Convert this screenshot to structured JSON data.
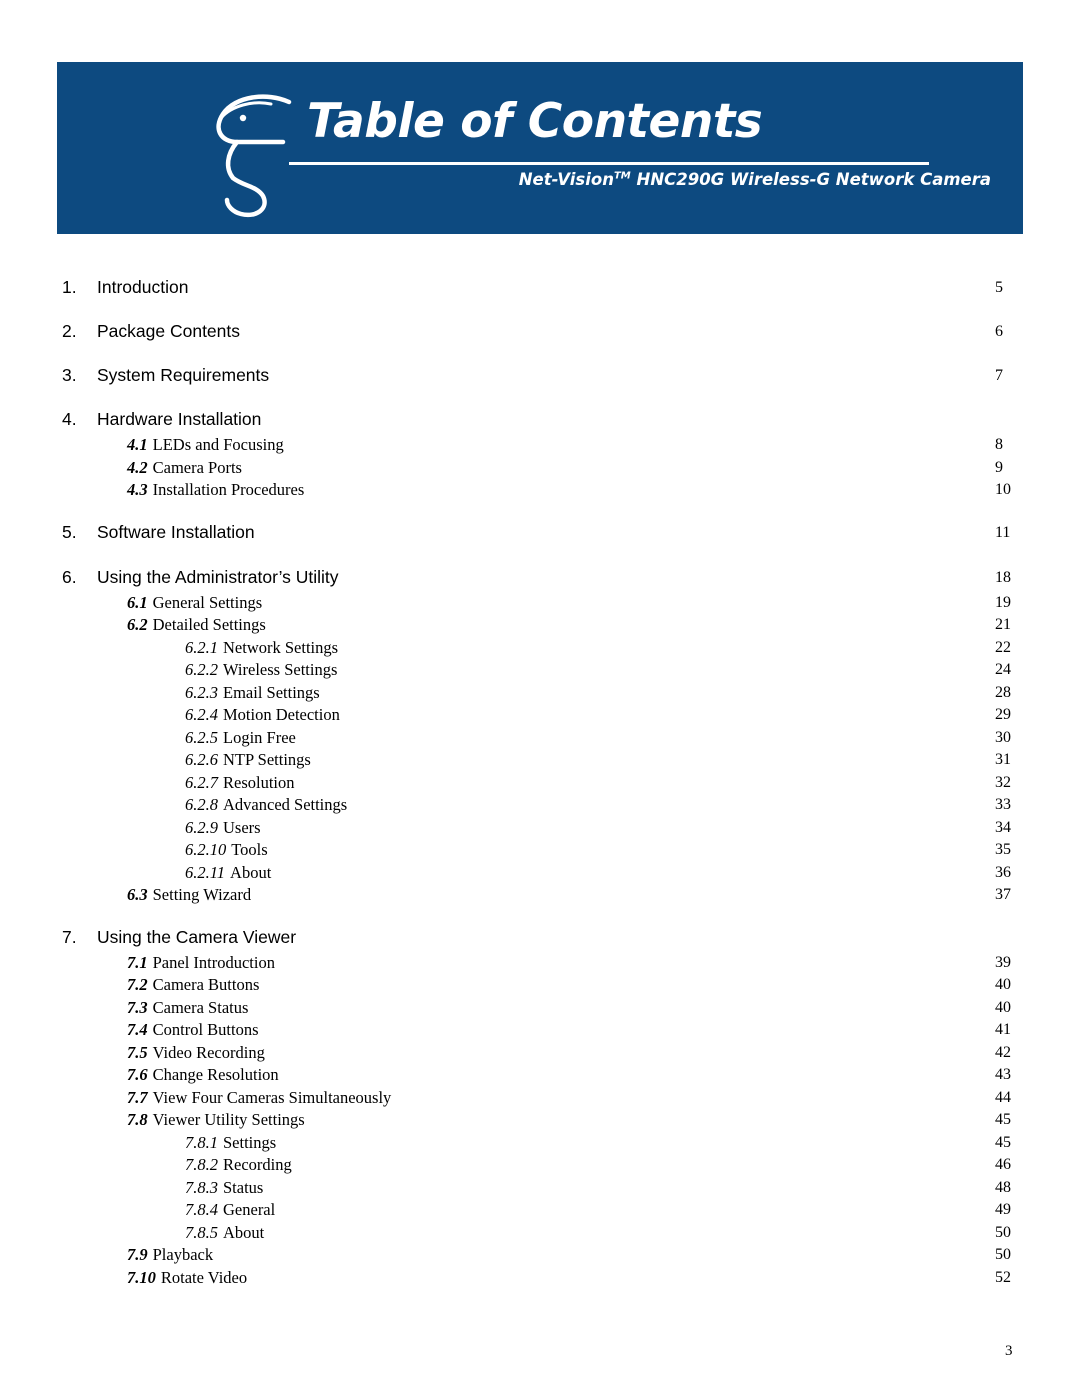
{
  "header": {
    "title": "Table of Contents",
    "subtitle_prefix": "Net-Vision",
    "subtitle_tm": "TM",
    "subtitle_rest": " HNC290G Wireless-G Network Camera",
    "banner_color": "#0d4a80",
    "logo_icon": "bird-head-logo"
  },
  "toc": {
    "entries": [
      {
        "level": 1,
        "num": "1.",
        "label": "Introduction",
        "page": "5",
        "spaced": false
      },
      {
        "level": 1,
        "num": "2.",
        "label": "Package Contents",
        "page": "6",
        "spaced": false
      },
      {
        "level": 1,
        "num": "3.",
        "label": "System Requirements",
        "page": "7",
        "spaced": false
      },
      {
        "level": 1,
        "num": "4.",
        "label": "Hardware Installation",
        "page": "",
        "spaced": false
      },
      {
        "level": 2,
        "num": "4.1",
        "label": "LEDs and Focusing",
        "page": "8",
        "spaced": false
      },
      {
        "level": 2,
        "num": "4.2",
        "label": "Camera Ports",
        "page": "9",
        "spaced": false
      },
      {
        "level": 2,
        "num": "4.3",
        "label": "Installation Procedures",
        "page": "10",
        "spaced": false
      },
      {
        "level": 1,
        "num": "5.",
        "label": "Software Installation",
        "page": "11",
        "spaced": true
      },
      {
        "level": 1,
        "num": "6.",
        "label": "Using the Administrator’s Utility",
        "page": "18",
        "spaced": true
      },
      {
        "level": 2,
        "num": "6.1",
        "label": "General Settings",
        "page": "19",
        "spaced": false
      },
      {
        "level": 2,
        "num": "6.2",
        "label": "Detailed Settings",
        "page": "21",
        "spaced": false
      },
      {
        "level": 3,
        "num": "6.2.1",
        "label": "Network Settings",
        "page": "22",
        "spaced": false
      },
      {
        "level": 3,
        "num": "6.2.2",
        "label": "Wireless Settings",
        "page": "24",
        "spaced": false
      },
      {
        "level": 3,
        "num": "6.2.3",
        "label": "Email Settings",
        "page": "28",
        "spaced": false
      },
      {
        "level": 3,
        "num": "6.2.4",
        "label": "Motion Detection",
        "page": "29",
        "spaced": false
      },
      {
        "level": 3,
        "num": "6.2.5",
        "label": "Login Free",
        "page": "30",
        "spaced": false
      },
      {
        "level": 3,
        "num": "6.2.6",
        "label": "NTP Settings",
        "page": "31",
        "spaced": false
      },
      {
        "level": 3,
        "num": "6.2.7",
        "label": "Resolution",
        "page": "32",
        "spaced": false
      },
      {
        "level": 3,
        "num": "6.2.8",
        "label": "Advanced Settings",
        "page": "33",
        "spaced": false
      },
      {
        "level": 3,
        "num": "6.2.9",
        "label": "Users",
        "page": "34",
        "spaced": false
      },
      {
        "level": 3,
        "num": "6.2.10",
        "label": "Tools",
        "page": "35",
        "spaced": false
      },
      {
        "level": 3,
        "num": "6.2.11",
        "label": "About",
        "page": "36",
        "spaced": false
      },
      {
        "level": 2,
        "num": "6.3",
        "label": "Setting Wizard",
        "page": "37",
        "spaced": false
      },
      {
        "level": 1,
        "num": "7.",
        "label": "Using the Camera Viewer",
        "page": "",
        "spaced": true
      },
      {
        "level": 2,
        "num": "7.1",
        "label": "Panel Introduction",
        "page": "39",
        "spaced": false
      },
      {
        "level": 2,
        "num": "7.2",
        "label": "Camera Buttons",
        "page": "40",
        "spaced": false
      },
      {
        "level": 2,
        "num": "7.3",
        "label": "Camera Status",
        "page": "40",
        "spaced": false
      },
      {
        "level": 2,
        "num": "7.4",
        "label": "Control Buttons",
        "page": "41",
        "spaced": false
      },
      {
        "level": 2,
        "num": "7.5",
        "label": "Video Recording",
        "page": "42",
        "spaced": false
      },
      {
        "level": 2,
        "num": "7.6",
        "label": "Change Resolution",
        "page": "43",
        "spaced": false
      },
      {
        "level": 2,
        "num": "7.7",
        "label": "View Four Cameras Simultaneously",
        "page": "44",
        "spaced": false
      },
      {
        "level": 2,
        "num": "7.8",
        "label": "Viewer Utility Settings",
        "page": "45",
        "spaced": false
      },
      {
        "level": 3,
        "num": "7.8.1",
        "label": "Settings",
        "page": "45",
        "spaced": false
      },
      {
        "level": 3,
        "num": "7.8.2",
        "label": "Recording",
        "page": "46",
        "spaced": false
      },
      {
        "level": 3,
        "num": "7.8.3",
        "label": "Status",
        "page": "48",
        "spaced": false
      },
      {
        "level": 3,
        "num": "7.8.4",
        "label": "General",
        "page": "49",
        "spaced": false
      },
      {
        "level": 3,
        "num": "7.8.5",
        "label": "About",
        "page": "50",
        "spaced": false
      },
      {
        "level": 2,
        "num": "7.9",
        "label": "Playback",
        "page": "50",
        "spaced": false
      },
      {
        "level": 2,
        "num": "7.10",
        "label": "Rotate Video",
        "page": "52",
        "spaced": false
      }
    ]
  },
  "footer": {
    "page_number": "3"
  }
}
